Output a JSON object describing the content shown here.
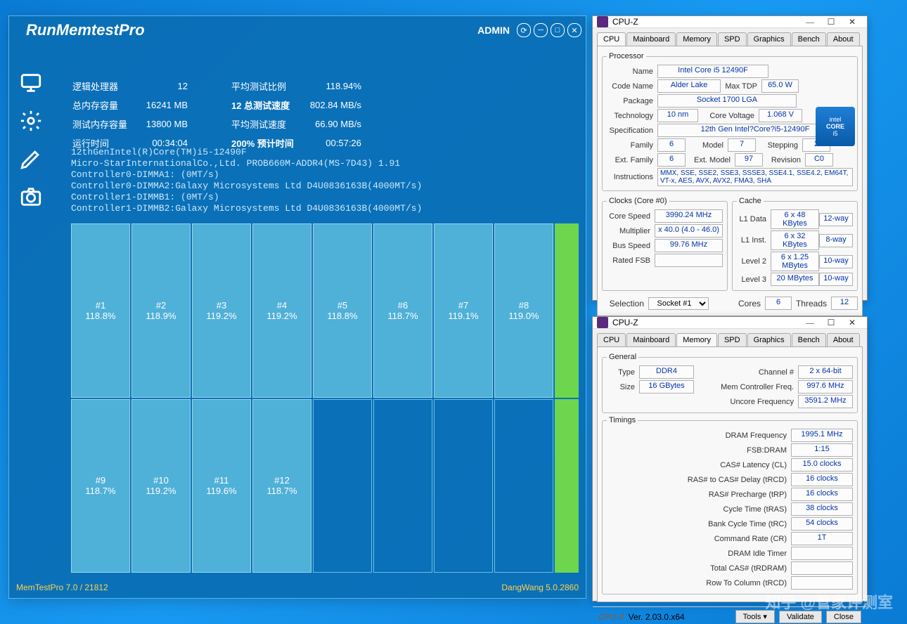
{
  "memtest": {
    "title": "RunMemtestPro",
    "admin": "ADMIN",
    "labels": {
      "lp": "逻辑处理器",
      "lpVal": "12",
      "avgRatio": "平均测试比例",
      "avgRatioVal": "118.94%",
      "totalMem": "总内存容量",
      "totalMemVal": "16241 MB",
      "totalSpeed": "12 总测试速度",
      "totalSpeedVal": "802.84 MB/s",
      "testMem": "测试内存容量",
      "testMemVal": "13800 MB",
      "avgSpeed": "平均测试速度",
      "avgSpeedVal": "66.90 MB/s",
      "runtime": "运行时间",
      "runtimeVal": "00:34:04",
      "estTime": "200% 预计时间",
      "estTimeVal": "00:57:26"
    },
    "sysinfo": "12thGenIntel(R)Core(TM)i5-12490F\nMicro-StarInternationalCo.,Ltd. PROB660M-ADDR4(MS-7D43) 1.91\nController0-DIMMA1: (0MT/s)\nController0-DIMMA2:Galaxy Microsystems Ltd D4U0836163B(4000MT/s)\nController1-DIMMB1: (0MT/s)\nController1-DIMMB2:Galaxy Microsystems Ltd D4U0836163B(4000MT/s)",
    "cells": [
      {
        "id": "#1",
        "v": "118.8%"
      },
      {
        "id": "#2",
        "v": "118.9%"
      },
      {
        "id": "#3",
        "v": "119.2%"
      },
      {
        "id": "#4",
        "v": "119.2%"
      },
      {
        "id": "#5",
        "v": "118.8%"
      },
      {
        "id": "#6",
        "v": "118.7%"
      },
      {
        "id": "#7",
        "v": "119.1%"
      },
      {
        "id": "#8",
        "v": "119.0%"
      },
      {
        "id": "#9",
        "v": "118.7%"
      },
      {
        "id": "#10",
        "v": "119.2%"
      },
      {
        "id": "#11",
        "v": "119.6%"
      },
      {
        "id": "#12",
        "v": "118.7%"
      }
    ],
    "footerL": "MemTestPro 7.0 / 21812",
    "footerR": "DangWang 5.0.2860"
  },
  "cpuz": {
    "title": "CPU-Z",
    "tabs": [
      "CPU",
      "Mainboard",
      "Memory",
      "SPD",
      "Graphics",
      "Bench",
      "About"
    ],
    "proc": {
      "legend": "Processor",
      "name": "Name",
      "nameV": "Intel Core i5 12490F",
      "code": "Code Name",
      "codeV": "Alder Lake",
      "tdp": "Max TDP",
      "tdpV": "65.0 W",
      "pkg": "Package",
      "pkgV": "Socket 1700 LGA",
      "tech": "Technology",
      "techV": "10 nm",
      "cv": "Core Voltage",
      "cvV": "1.068 V",
      "spec": "Specification",
      "specV": "12th Gen Intel?Core?i5-12490F",
      "fam": "Family",
      "famV": "6",
      "mod": "Model",
      "modV": "7",
      "step": "Stepping",
      "stepV": "2",
      "efam": "Ext. Family",
      "efamV": "6",
      "emod": "Ext. Model",
      "emodV": "97",
      "rev": "Revision",
      "revV": "C0",
      "inst": "Instructions",
      "instV": "MMX, SSE, SSE2, SSE3, SSSE3, SSE4.1, SSE4.2, EM64T, VT-x, AES, AVX, AVX2, FMA3, SHA"
    },
    "clocks": {
      "legend": "Clocks (Core #0)",
      "cs": "Core Speed",
      "csV": "3990.24 MHz",
      "mul": "Multiplier",
      "mulV": "x 40.0 (4.0 - 46.0)",
      "bs": "Bus Speed",
      "bsV": "99.76 MHz",
      "fsb": "Rated FSB",
      "fsbV": ""
    },
    "cache": {
      "legend": "Cache",
      "l1d": "L1 Data",
      "l1dV": "6 x 48 KBytes",
      "l1dW": "12-way",
      "l1i": "L1 Inst.",
      "l1iV": "6 x 32 KBytes",
      "l1iW": "8-way",
      "l2": "Level 2",
      "l2V": "6 x 1.25 MBytes",
      "l2W": "10-way",
      "l3": "Level 3",
      "l3V": "20 MBytes",
      "l3W": "10-way"
    },
    "sel": "Selection",
    "selV": "Socket #1",
    "cores": "Cores",
    "coresV": "6",
    "threads": "Threads",
    "threadsV": "12",
    "ver": "Ver. 2.03.0.x64",
    "tools": "Tools",
    "validate": "Validate",
    "close": "Close",
    "intel": {
      "brand": "intel",
      "core": "CORE",
      "sku": "i5"
    },
    "mem": {
      "legendG": "General",
      "type": "Type",
      "typeV": "DDR4",
      "ch": "Channel #",
      "chV": "2 x 64-bit",
      "size": "Size",
      "sizeV": "16 GBytes",
      "mcf": "Mem Controller Freq.",
      "mcfV": "997.6 MHz",
      "uf": "Uncore Frequency",
      "ufV": "3591.2 MHz",
      "legendT": "Timings",
      "rows": [
        [
          "DRAM Frequency",
          "1995.1 MHz"
        ],
        [
          "FSB:DRAM",
          "1:15"
        ],
        [
          "CAS# Latency (CL)",
          "15.0 clocks"
        ],
        [
          "RAS# to CAS# Delay (tRCD)",
          "16 clocks"
        ],
        [
          "RAS# Precharge (tRP)",
          "16 clocks"
        ],
        [
          "Cycle Time (tRAS)",
          "38 clocks"
        ],
        [
          "Bank Cycle Time (tRC)",
          "54 clocks"
        ],
        [
          "Command Rate (CR)",
          "1T"
        ],
        [
          "DRAM Idle Timer",
          ""
        ],
        [
          "Total CAS# (tRDRAM)",
          ""
        ],
        [
          "Row To Column (tRCD)",
          ""
        ]
      ]
    }
  },
  "watermark": "知乎 @管家评测室"
}
